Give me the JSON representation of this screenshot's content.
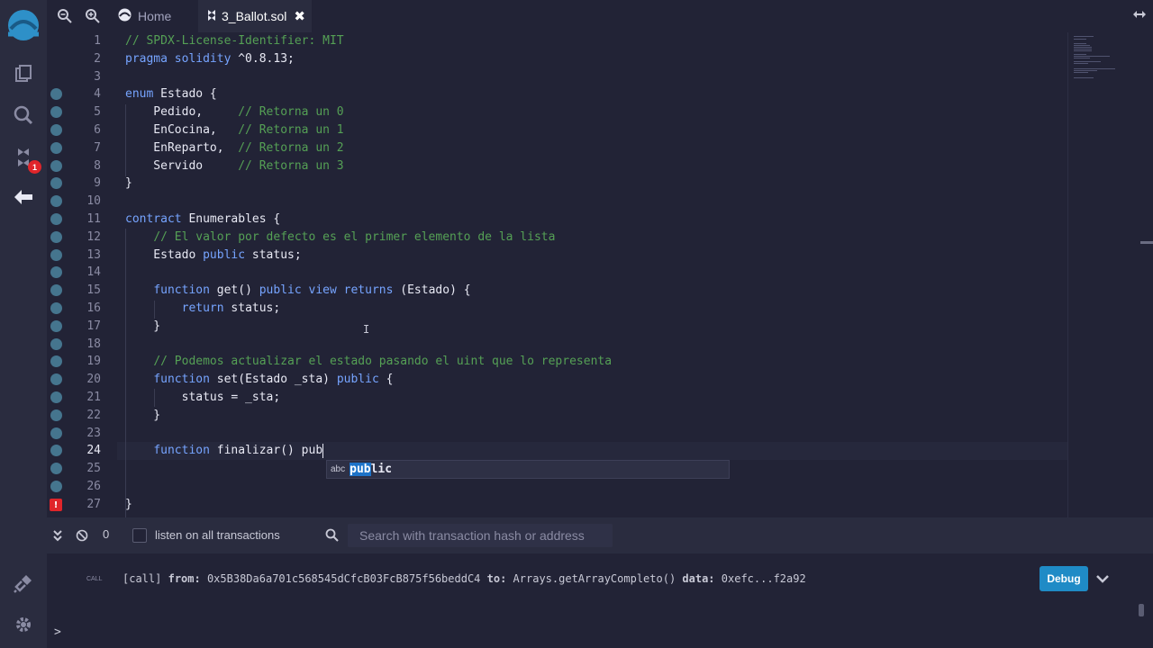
{
  "tabs": {
    "home_label": "Home",
    "file_label": "3_Ballot.sol"
  },
  "editor": {
    "line_numbers": [
      "1",
      "2",
      "3",
      "4",
      "5",
      "6",
      "7",
      "8",
      "9",
      "10",
      "11",
      "12",
      "13",
      "14",
      "15",
      "16",
      "17",
      "18",
      "19",
      "20",
      "21",
      "22",
      "23",
      "24",
      "25",
      "26",
      "27"
    ],
    "active_line": "24",
    "lines": [
      [
        {
          "t": "cm",
          "v": "// SPDX-License-Identifier: MIT"
        }
      ],
      [
        {
          "t": "kw",
          "v": "pragma solidity"
        },
        {
          "t": "tp",
          "v": " ^0.8.13;"
        }
      ],
      [],
      [
        {
          "t": "kw",
          "v": "enum"
        },
        {
          "t": "tp",
          "v": " Estado {"
        }
      ],
      [
        {
          "t": "tp",
          "v": "    Pedido,     "
        },
        {
          "t": "cm",
          "v": "// Retorna un 0"
        }
      ],
      [
        {
          "t": "tp",
          "v": "    EnCocina,   "
        },
        {
          "t": "cm",
          "v": "// Retorna un 1"
        }
      ],
      [
        {
          "t": "tp",
          "v": "    EnReparto,  "
        },
        {
          "t": "cm",
          "v": "// Retorna un 2"
        }
      ],
      [
        {
          "t": "tp",
          "v": "    Servido     "
        },
        {
          "t": "cm",
          "v": "// Retorna un 3"
        }
      ],
      [
        {
          "t": "tp",
          "v": "}"
        }
      ],
      [],
      [
        {
          "t": "kw",
          "v": "contract"
        },
        {
          "t": "tp",
          "v": " Enumerables {"
        }
      ],
      [
        {
          "t": "tp",
          "v": "    "
        },
        {
          "t": "cm",
          "v": "// El valor por defecto es el primer elemento de la lista"
        }
      ],
      [
        {
          "t": "tp",
          "v": "    Estado "
        },
        {
          "t": "kw",
          "v": "public"
        },
        {
          "t": "tp",
          "v": " status;"
        }
      ],
      [],
      [
        {
          "t": "tp",
          "v": "    "
        },
        {
          "t": "kw",
          "v": "function"
        },
        {
          "t": "tp",
          "v": " get() "
        },
        {
          "t": "kw",
          "v": "public view returns"
        },
        {
          "t": "tp",
          "v": " (Estado) {"
        }
      ],
      [
        {
          "t": "tp",
          "v": "        "
        },
        {
          "t": "kw",
          "v": "return"
        },
        {
          "t": "tp",
          "v": " status;"
        }
      ],
      [
        {
          "t": "tp",
          "v": "    }"
        }
      ],
      [],
      [
        {
          "t": "tp",
          "v": "    "
        },
        {
          "t": "cm",
          "v": "// Podemos actualizar el estado pasando el uint que lo representa"
        }
      ],
      [
        {
          "t": "tp",
          "v": "    "
        },
        {
          "t": "kw",
          "v": "function"
        },
        {
          "t": "tp",
          "v": " set(Estado _sta) "
        },
        {
          "t": "kw",
          "v": "public"
        },
        {
          "t": "tp",
          "v": " {"
        }
      ],
      [
        {
          "t": "tp",
          "v": "        status = _sta;"
        }
      ],
      [
        {
          "t": "tp",
          "v": "    }"
        }
      ],
      [],
      [
        {
          "t": "tp",
          "v": "    "
        },
        {
          "t": "kw",
          "v": "function"
        },
        {
          "t": "tp",
          "v": " finalizar() pub"
        }
      ],
      [],
      [],
      [
        {
          "t": "tp",
          "v": "}"
        }
      ]
    ],
    "suggestion": {
      "kind": "abc",
      "match": "pub",
      "rest": "lic"
    }
  },
  "terminal": {
    "count": "0",
    "listen_label": "listen on all transactions",
    "search_placeholder": "Search with transaction hash or address",
    "call_tag": "CALL",
    "log": {
      "call": "[call]",
      "from_label": "from:",
      "from": "0x5B38Da6a701c568545dCfcB03FcB875f56beddC4",
      "to_label": "to:",
      "to": "Arrays.getArrayCompleto()",
      "data_label": "data:",
      "data": "0xefc...f2a92"
    },
    "debug_label": "Debug",
    "prompt": ">"
  },
  "icons": {
    "rail": [
      "remix-logo-icon",
      "file-explorer-icon",
      "search-icon",
      "solidity-compiler-icon",
      "deploy-run-icon",
      "plugin-manager-icon",
      "settings-icon"
    ],
    "compiler_badge": "1"
  }
}
